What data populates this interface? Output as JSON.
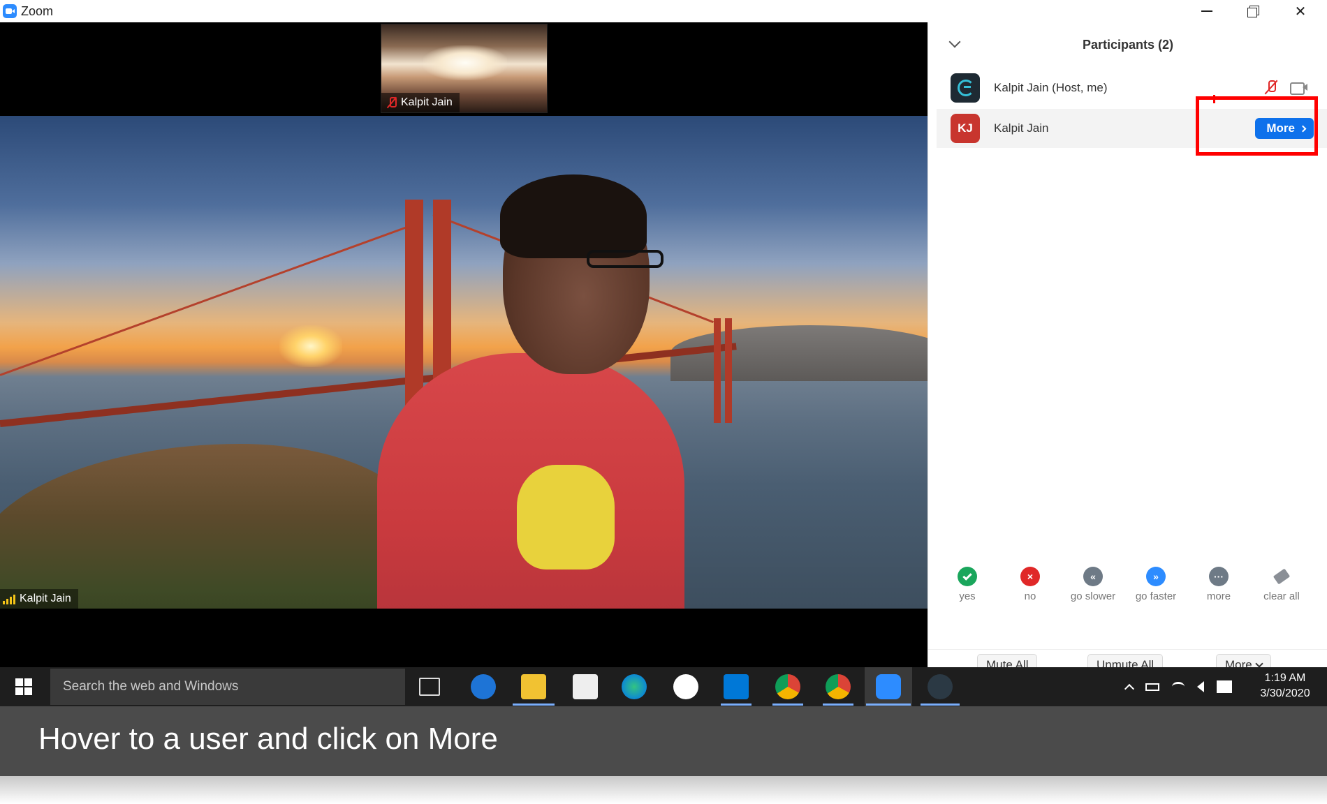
{
  "window": {
    "app_title": "Zoom"
  },
  "video": {
    "thumb_name": "Kalpit Jain",
    "main_name": "Kalpit Jain"
  },
  "participants": {
    "title": "Participants (2)",
    "list": [
      {
        "name": "Kalpit Jain (Host, me)",
        "avatar": "G"
      },
      {
        "name": "Kalpit Jain",
        "avatar": "KJ",
        "action": "More"
      }
    ]
  },
  "reactions": [
    {
      "label": "yes",
      "icon": "check-icon"
    },
    {
      "label": "no",
      "icon": "x-icon",
      "glyph": "×"
    },
    {
      "label": "go slower",
      "icon": "rewind-icon",
      "glyph": "«"
    },
    {
      "label": "go faster",
      "icon": "fast-forward-icon",
      "glyph": "»"
    },
    {
      "label": "more",
      "icon": "ellipsis-icon",
      "glyph": "···"
    },
    {
      "label": "clear all",
      "icon": "eraser-icon"
    }
  ],
  "controls": {
    "mute_all": "Mute All",
    "unmute_all": "Unmute All",
    "more": "More"
  },
  "taskbar": {
    "search_placeholder": "Search the web and Windows",
    "time": "1:19 AM",
    "date": "3/30/2020"
  },
  "caption": {
    "text": "Hover to a user and click on More"
  },
  "colors": {
    "accent": "#0e71eb",
    "highlight": "#ff0000",
    "muted": "#e02828"
  }
}
